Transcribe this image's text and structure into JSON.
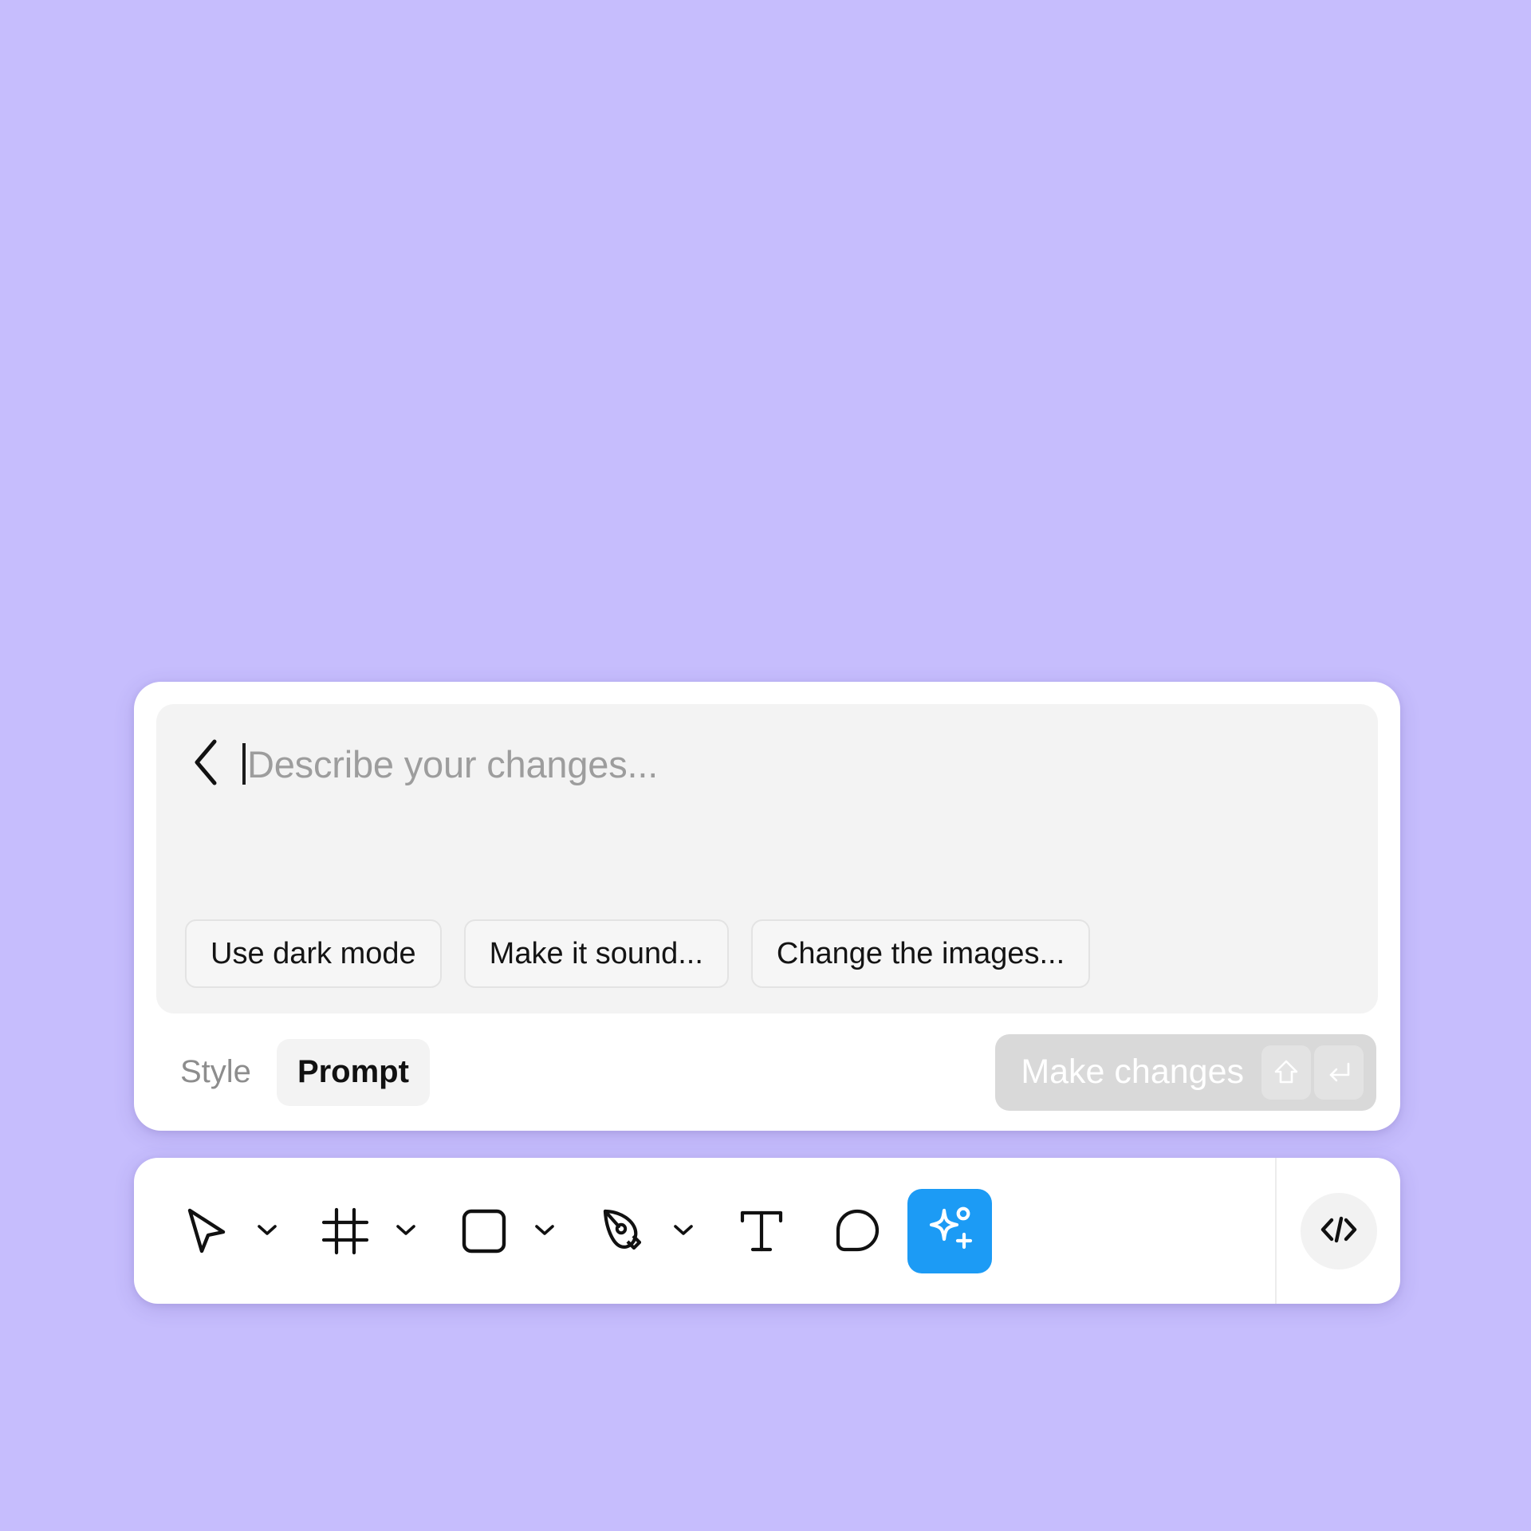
{
  "canvas": {
    "background_color": "#c6bdfd"
  },
  "prompt_panel": {
    "back_icon": "chevron-left-icon",
    "input": {
      "value": "",
      "placeholder": "Describe your changes..."
    },
    "suggestions": [
      {
        "label": "Use dark mode"
      },
      {
        "label": "Make it sound..."
      },
      {
        "label": "Change the images..."
      }
    ],
    "modes": [
      {
        "label": "Style",
        "active": false
      },
      {
        "label": "Prompt",
        "active": true
      }
    ],
    "submit": {
      "label": "Make changes",
      "enabled": false,
      "shortcut_keys": [
        "shift-key-icon",
        "enter-key-icon"
      ],
      "background_color": "#d9d9d9"
    }
  },
  "toolbar": {
    "tools": [
      {
        "name": "cursor",
        "icon": "cursor-arrow-icon",
        "has_dropdown": true,
        "active": false
      },
      {
        "name": "frame",
        "icon": "frame-icon",
        "has_dropdown": true,
        "active": false
      },
      {
        "name": "shape",
        "icon": "square-icon",
        "has_dropdown": true,
        "active": false
      },
      {
        "name": "pen",
        "icon": "pen-tool-icon",
        "has_dropdown": true,
        "active": false
      },
      {
        "name": "text",
        "icon": "text-type-icon",
        "has_dropdown": false,
        "active": false
      },
      {
        "name": "comment",
        "icon": "comment-bubble-icon",
        "has_dropdown": false,
        "active": false
      },
      {
        "name": "ai",
        "icon": "ai-sparkle-plus-icon",
        "has_dropdown": false,
        "active": true,
        "accent_color": "#1c9bf5"
      }
    ],
    "dev_mode": {
      "icon": "code-brackets-icon"
    }
  }
}
